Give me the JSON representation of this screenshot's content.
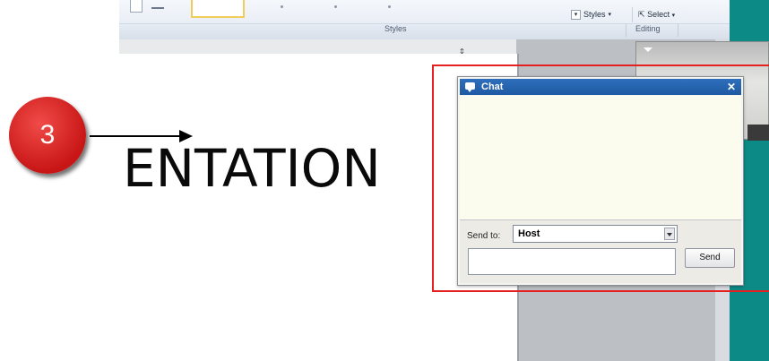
{
  "ribbon": {
    "styles_button": "Styles",
    "select_button": "Select",
    "groups": {
      "styles": "Styles",
      "editing": "Editing"
    }
  },
  "document": {
    "visible_text": "ENTATION"
  },
  "annotation": {
    "step_number": "3",
    "highlight_color": "#e52020",
    "badge_color": "#d42323"
  },
  "chat": {
    "title": "Chat",
    "close_glyph": "✕",
    "send_to_label": "Send to:",
    "send_to_value": "Host",
    "message_value": "",
    "send_button": "Send"
  },
  "colors": {
    "chat_title_bar": "#2563ae",
    "taskbar_teal": "#0c8a86"
  },
  "icons": [
    "chat-bubble-icon",
    "close-icon",
    "dropdown-arrow-icon",
    "resize-handle-icon",
    "dialog-launcher-icon"
  ]
}
